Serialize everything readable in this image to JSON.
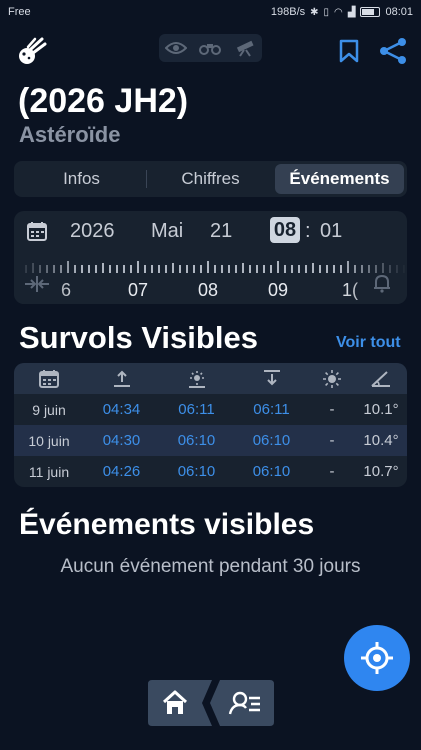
{
  "status_bar": {
    "carrier": "Free",
    "speed": "198B/s",
    "time": "08:01"
  },
  "header": {
    "icons": [
      "comet-logo-icon",
      "eye-icon",
      "binoculars-icon",
      "telescope-icon",
      "bookmark-icon",
      "share-icon"
    ],
    "accent": "#3d8fe8"
  },
  "object": {
    "name": "(2026 JH2)",
    "type": "Astéroïde"
  },
  "tabs": [
    {
      "label": "Infos",
      "active": false
    },
    {
      "label": "Chiffres",
      "active": false
    },
    {
      "label": "Événements",
      "active": true
    }
  ],
  "datetime": {
    "year": "2026",
    "month": "Mai",
    "day": "21",
    "hour": "08",
    "separator": ":",
    "minute": "01"
  },
  "timeline": {
    "labels": [
      "6",
      "07",
      "08",
      "09",
      "1("
    ]
  },
  "passes": {
    "title": "Survols Visibles",
    "see_all": "Voir tout",
    "header_icons": [
      "calendar-icon",
      "rise-icon",
      "transit-icon",
      "set-icon",
      "brightness-icon",
      "angle-icon"
    ],
    "rows": [
      {
        "date": "9 juin",
        "rise": "04:34",
        "transit": "06:11",
        "set": "06:11",
        "mag": "-",
        "alt": "10.1°"
      },
      {
        "date": "10 juin",
        "rise": "04:30",
        "transit": "06:10",
        "set": "06:10",
        "mag": "-",
        "alt": "10.4°"
      },
      {
        "date": "11 juin",
        "rise": "04:26",
        "transit": "06:10",
        "set": "06:10",
        "mag": "-",
        "alt": "10.7°"
      }
    ]
  },
  "events": {
    "title": "Événements visibles",
    "empty": "Aucun événement pendant 30 jours"
  },
  "fab": {
    "icon": "crosshair-icon",
    "color": "#2f86f0"
  },
  "bottom_nav": {
    "items": [
      "home-icon",
      "tonight-list-icon"
    ]
  }
}
